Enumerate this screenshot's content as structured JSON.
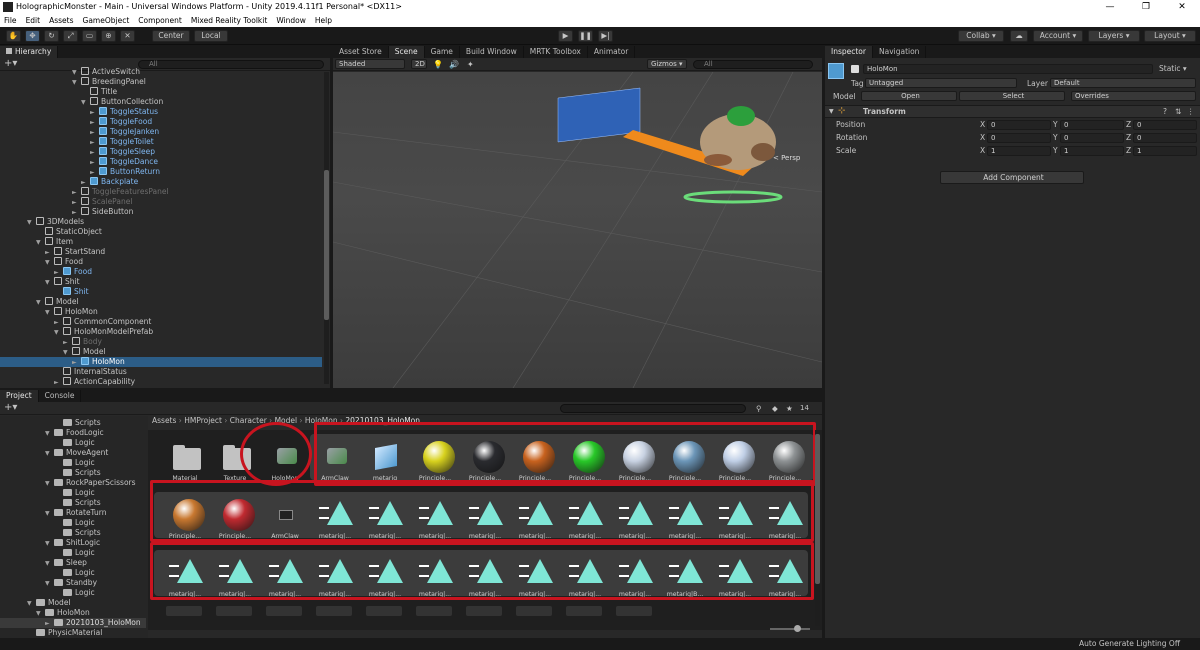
{
  "window": {
    "title": "HolographicMonster - Main - Universal Windows Platform - Unity 2019.4.11f1 Personal* <DX11>",
    "min": "—",
    "max": "❐",
    "close": "✕"
  },
  "menu": [
    "File",
    "Edit",
    "Assets",
    "GameObject",
    "Component",
    "Mixed Reality Toolkit",
    "Window",
    "Help"
  ],
  "toolbar": {
    "center": "Center",
    "local": "Local",
    "collab": "Collab ▾",
    "account": "Account ▾",
    "layers": "Layers ▾",
    "layout": "Layout ▾"
  },
  "hierarchy": {
    "tab": "Hierarchy",
    "search": "All",
    "rows": [
      {
        "t": "ActiveSwitch",
        "i": 8,
        "a": "▼",
        "c": "n"
      },
      {
        "t": "BreedingPanel",
        "i": 8,
        "a": "▼",
        "c": "n"
      },
      {
        "t": "Title",
        "i": 9,
        "a": "",
        "c": "n"
      },
      {
        "t": "ButtonCollection",
        "i": 9,
        "a": "▼",
        "c": "n"
      },
      {
        "t": "ToggleStatus",
        "i": 10,
        "a": "►",
        "c": "b"
      },
      {
        "t": "ToggleFood",
        "i": 10,
        "a": "►",
        "c": "b"
      },
      {
        "t": "ToggleJanken",
        "i": 10,
        "a": "►",
        "c": "b"
      },
      {
        "t": "ToggleToilet",
        "i": 10,
        "a": "►",
        "c": "b"
      },
      {
        "t": "ToggleSleep",
        "i": 10,
        "a": "►",
        "c": "b"
      },
      {
        "t": "ToggleDance",
        "i": 10,
        "a": "►",
        "c": "b"
      },
      {
        "t": "ButtonReturn",
        "i": 10,
        "a": "►",
        "c": "b"
      },
      {
        "t": "Backplate",
        "i": 9,
        "a": "►",
        "c": "b"
      },
      {
        "t": "ToggleFeaturesPanel",
        "i": 8,
        "a": "►",
        "c": "d"
      },
      {
        "t": "ScalePanel",
        "i": 8,
        "a": "►",
        "c": "d"
      },
      {
        "t": "SideButton",
        "i": 8,
        "a": "►",
        "c": "n"
      },
      {
        "t": "3DModels",
        "i": 3,
        "a": "▼",
        "c": "n"
      },
      {
        "t": "StaticObject",
        "i": 4,
        "a": "",
        "c": "n"
      },
      {
        "t": "Item",
        "i": 4,
        "a": "▼",
        "c": "n"
      },
      {
        "t": "StartStand",
        "i": 5,
        "a": "►",
        "c": "n"
      },
      {
        "t": "Food",
        "i": 5,
        "a": "▼",
        "c": "n"
      },
      {
        "t": "Food",
        "i": 6,
        "a": "►",
        "c": "b"
      },
      {
        "t": "Shit",
        "i": 5,
        "a": "▼",
        "c": "n"
      },
      {
        "t": "Shit",
        "i": 6,
        "a": "",
        "c": "b"
      },
      {
        "t": "Model",
        "i": 4,
        "a": "▼",
        "c": "n"
      },
      {
        "t": "HoloMon",
        "i": 5,
        "a": "▼",
        "c": "n"
      },
      {
        "t": "CommonComponent",
        "i": 6,
        "a": "►",
        "c": "n"
      },
      {
        "t": "HoloMonModelPrefab",
        "i": 6,
        "a": "▼",
        "c": "n"
      },
      {
        "t": "Body",
        "i": 7,
        "a": "►",
        "c": "d"
      },
      {
        "t": "Model",
        "i": 7,
        "a": "▼",
        "c": "n"
      },
      {
        "t": "HoloMon",
        "i": 8,
        "a": "►",
        "c": "s"
      },
      {
        "t": "InternalStatus",
        "i": 6,
        "a": "",
        "c": "n"
      },
      {
        "t": "ActionCapability",
        "i": 6,
        "a": "►",
        "c": "n"
      }
    ]
  },
  "scene": {
    "tabs": [
      "Asset Store",
      "Scene",
      "Game",
      "Build Window",
      "MRTK Toolbox",
      "Animator"
    ],
    "shading": "Shaded",
    "mode": "2D",
    "gizmos": "Gizmos ▾",
    "search": "All",
    "persp": "< Persp"
  },
  "inspector": {
    "tabs": [
      "Inspector",
      "Navigation"
    ],
    "name": "HoloMon",
    "static": "Static ▾",
    "tag_label": "Tag",
    "tag": "Untagged",
    "layer_label": "Layer",
    "layer": "Default",
    "model_label": "Model",
    "open": "Open",
    "select": "Select",
    "overrides": "Overrides",
    "component": "Transform",
    "position": {
      "label": "Position",
      "x": "0",
      "y": "0",
      "z": "0"
    },
    "rotation": {
      "label": "Rotation",
      "x": "0",
      "y": "0",
      "z": "0"
    },
    "scale": {
      "label": "Scale",
      "x": "1",
      "y": "1",
      "z": "1"
    },
    "add_component": "Add Component"
  },
  "project": {
    "tabs": [
      "Project",
      "Console"
    ],
    "count": "14",
    "breadcrumb": [
      "Assets",
      "HMProject",
      "Character",
      "Model",
      "HoloMon",
      "20210103_HoloMon"
    ],
    "tree": [
      {
        "t": "Scripts",
        "i": 6,
        "a": ""
      },
      {
        "t": "FoodLogic",
        "i": 5,
        "a": "▼"
      },
      {
        "t": "Logic",
        "i": 6,
        "a": ""
      },
      {
        "t": "MoveAgent",
        "i": 5,
        "a": "▼"
      },
      {
        "t": "Logic",
        "i": 6,
        "a": ""
      },
      {
        "t": "Scripts",
        "i": 6,
        "a": ""
      },
      {
        "t": "RockPaperScissors",
        "i": 5,
        "a": "▼"
      },
      {
        "t": "Logic",
        "i": 6,
        "a": ""
      },
      {
        "t": "Scripts",
        "i": 6,
        "a": ""
      },
      {
        "t": "RotateTurn",
        "i": 5,
        "a": "▼"
      },
      {
        "t": "Logic",
        "i": 6,
        "a": ""
      },
      {
        "t": "Scripts",
        "i": 6,
        "a": ""
      },
      {
        "t": "ShitLogic",
        "i": 5,
        "a": "▼"
      },
      {
        "t": "Logic",
        "i": 6,
        "a": ""
      },
      {
        "t": "Sleep",
        "i": 5,
        "a": "▼"
      },
      {
        "t": "Logic",
        "i": 6,
        "a": ""
      },
      {
        "t": "Standby",
        "i": 5,
        "a": "▼"
      },
      {
        "t": "Logic",
        "i": 6,
        "a": ""
      },
      {
        "t": "Model",
        "i": 3,
        "a": "▼"
      },
      {
        "t": "HoloMon",
        "i": 4,
        "a": "▼"
      },
      {
        "t": "20210103_HoloMon",
        "i": 5,
        "a": "►",
        "sel": true
      },
      {
        "t": "PhysicMaterial",
        "i": 3,
        "a": ""
      }
    ],
    "row1": [
      {
        "l": "Material",
        "k": "folder"
      },
      {
        "l": "Texture",
        "k": "folder"
      },
      {
        "l": "HoloMon",
        "k": "model"
      },
      {
        "l": "ArmClaw",
        "k": "model"
      },
      {
        "l": "metarig",
        "k": "mesh"
      },
      {
        "l": "Principle...",
        "k": "sphere",
        "c": "#d8d21e"
      },
      {
        "l": "Principle...",
        "k": "sphere",
        "c": "#2a2b2f"
      },
      {
        "l": "Principle...",
        "k": "sphere",
        "c": "#c8621e"
      },
      {
        "l": "Principle...",
        "k": "sphere",
        "c": "#28c828"
      },
      {
        "l": "Principle...",
        "k": "sphere",
        "c": "#c8d2e2"
      },
      {
        "l": "Principle...",
        "k": "sphere",
        "c": "#6c96b8"
      },
      {
        "l": "Principle...",
        "k": "sphere",
        "c": "#c0cfe6"
      },
      {
        "l": "Principle...",
        "k": "sphere",
        "c": "#8e9294"
      }
    ],
    "row2": [
      {
        "l": "Principle...",
        "k": "sphere",
        "c": "#c87830"
      },
      {
        "l": "Principle...",
        "k": "sphere",
        "c": "#c02a30"
      },
      {
        "l": "ArmClaw",
        "k": "mesh2"
      },
      {
        "l": "metarig|...",
        "k": "anim"
      },
      {
        "l": "metarig|...",
        "k": "anim"
      },
      {
        "l": "metarig|...",
        "k": "anim"
      },
      {
        "l": "metarig|...",
        "k": "anim"
      },
      {
        "l": "metarig|...",
        "k": "anim"
      },
      {
        "l": "metarig|...",
        "k": "anim"
      },
      {
        "l": "metarig|...",
        "k": "anim"
      },
      {
        "l": "metarig|...",
        "k": "anim"
      },
      {
        "l": "metarig|...",
        "k": "anim"
      },
      {
        "l": "metarig|...",
        "k": "anim"
      }
    ],
    "row3": [
      {
        "l": "metarig|...",
        "k": "anim"
      },
      {
        "l": "metarig|...",
        "k": "anim"
      },
      {
        "l": "metarig|...",
        "k": "anim"
      },
      {
        "l": "metarig|...",
        "k": "anim"
      },
      {
        "l": "metarig|...",
        "k": "anim"
      },
      {
        "l": "metarig|...",
        "k": "anim"
      },
      {
        "l": "metarig|...",
        "k": "anim"
      },
      {
        "l": "metarig|...",
        "k": "anim"
      },
      {
        "l": "metarig|...",
        "k": "anim"
      },
      {
        "l": "metarig|...",
        "k": "anim"
      },
      {
        "l": "metarig|B...",
        "k": "anim"
      },
      {
        "l": "metarig|...",
        "k": "anim"
      },
      {
        "l": "metarig|...",
        "k": "anim"
      }
    ]
  },
  "status": "Auto Generate Lighting Off",
  "colors": {
    "accent": "#2c5d87",
    "highlight": "#c8141f",
    "anim": "#7fe6d6"
  }
}
